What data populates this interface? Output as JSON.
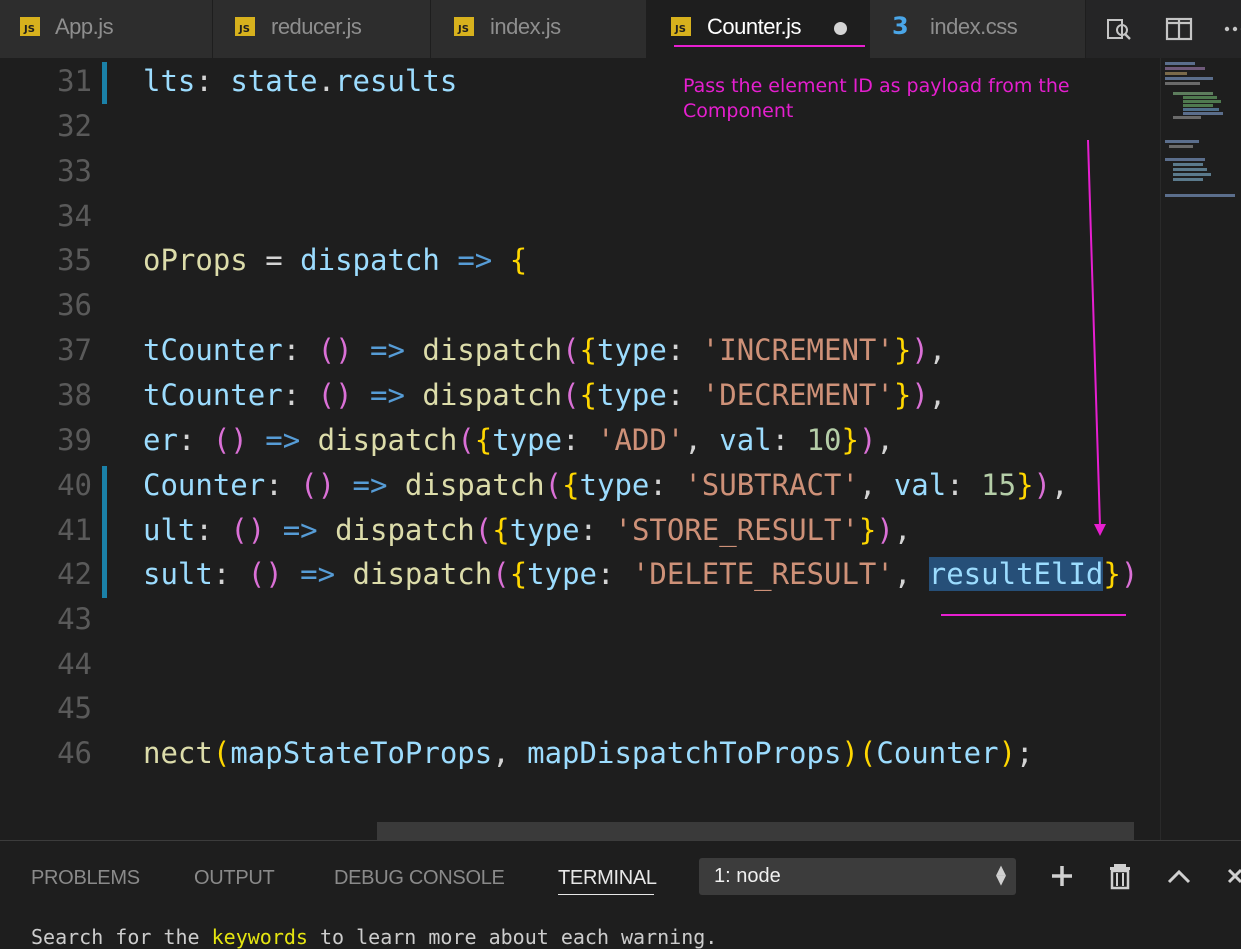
{
  "tabs": [
    {
      "label": "App.js",
      "icon": "js-file-icon"
    },
    {
      "label": "reducer.js",
      "icon": "js-file-icon"
    },
    {
      "label": "index.js",
      "icon": "js-file-icon"
    },
    {
      "label": "Counter.js",
      "icon": "js-file-icon",
      "active": true,
      "unsaved": true
    },
    {
      "label": "index.css",
      "icon": "css-file-icon"
    }
  ],
  "icon_glyphs": {
    "js": "JS",
    "css": "3"
  },
  "toolbar_icons": [
    "open-changes-icon",
    "split-editor-icon",
    "more-actions-icon"
  ],
  "annotation": "Pass the element ID as payload from the Component",
  "lines": [
    {
      "n": "31",
      "text": "lts: state.results"
    },
    {
      "n": "32",
      "text": ""
    },
    {
      "n": "33",
      "text": ""
    },
    {
      "n": "34",
      "text": ""
    },
    {
      "n": "35",
      "text": "oProps = dispatch => {"
    },
    {
      "n": "36",
      "text": ""
    },
    {
      "n": "37",
      "text": "tCounter: () => dispatch({type: 'INCREMENT'}),"
    },
    {
      "n": "38",
      "text": "tCounter: () => dispatch({type: 'DECREMENT'}),"
    },
    {
      "n": "39",
      "text": "er: () => dispatch({type: 'ADD', val: 10}),"
    },
    {
      "n": "40",
      "text": "Counter: () => dispatch({type: 'SUBTRACT', val: 15}),"
    },
    {
      "n": "41",
      "text": "ult: () => dispatch({type: 'STORE_RESULT'}),"
    },
    {
      "n": "42",
      "text": "sult: () => dispatch({type: 'DELETE_RESULT', resultElId})"
    },
    {
      "n": "43",
      "text": ""
    },
    {
      "n": "44",
      "text": ""
    },
    {
      "n": "45",
      "text": ""
    },
    {
      "n": "46",
      "text": "nect(mapStateToProps, mapDispatchToProps)(Counter);"
    }
  ],
  "selection": "resultElId",
  "panel": {
    "tabs": [
      "PROBLEMS",
      "OUTPUT",
      "DEBUG CONSOLE",
      "TERMINAL"
    ],
    "active_tab": "TERMINAL",
    "terminal_select": "1: node",
    "terminal_text": "Search for the keywords to learn more about each warning.",
    "terminal_highlight": "keywords"
  },
  "colors": {
    "accent_annotation": "#e71fd0",
    "selection": "#264f78",
    "gutter_modified": "#1b81a8",
    "js_icon": "#d7b11d",
    "css_icon": "#4aa6e8"
  }
}
